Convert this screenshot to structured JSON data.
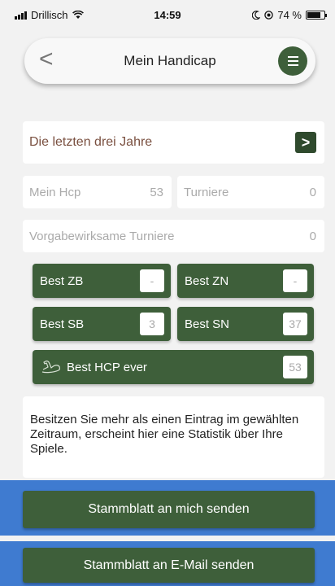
{
  "status_bar": {
    "carrier": "Drillisch",
    "time": "14:59",
    "battery": "74 %",
    "battery_level": 0.74
  },
  "nav": {
    "back_glyph": "<",
    "title": "Mein Handicap",
    "menu_icon": "hamburger-menu-icon"
  },
  "period": {
    "label": "Die letzten drei Jahre",
    "button_glyph": ">"
  },
  "stats": {
    "hcp_label": "Mein Hcp",
    "hcp_value": "53",
    "turniere_label": "Turniere",
    "turniere_value": "0",
    "vorgabe_label": "Vorgabewirksame Turniere",
    "vorgabe_value": "0"
  },
  "best": {
    "zb_label": "Best ZB",
    "zb_value": "-",
    "zn_label": "Best ZN",
    "zn_value": "-",
    "sb_label": "Best SB",
    "sb_value": "3",
    "sn_label": "Best SN",
    "sn_value": "37",
    "ever_label": "Best HCP ever",
    "ever_value": "53",
    "ever_icon": "flexed-arm-icon"
  },
  "info_text": "Besitzen Sie mehr als einen Eintrag im gewählten Zeitraum, erscheint hier eine Statistik über Ihre Spiele.",
  "actions": {
    "send_me": "Stammblatt an mich senden",
    "send_email": "Stammblatt an E-Mail senden"
  },
  "colors": {
    "accent_green": "#3e5f3a",
    "highlight_blue": "#3f7bd0",
    "background": "#f2f2f2"
  }
}
